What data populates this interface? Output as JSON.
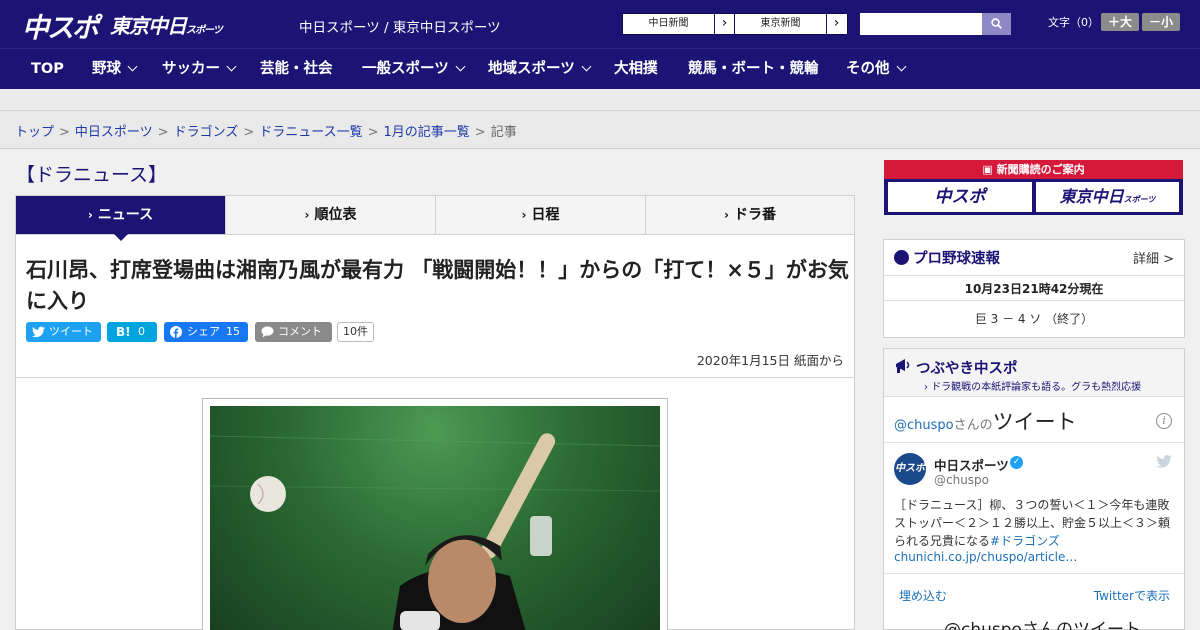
{
  "header": {
    "logo_main": "中スポ",
    "logo_sub": "東京中日",
    "logo_sub_small": "スポーツ",
    "site_links": "中日スポーツ / 東京中日スポーツ",
    "paper_buttons": [
      "中日新聞",
      "東京新聞"
    ],
    "search_placeholder": "",
    "font_size_label": "文字（0）",
    "font_plus": "＋大",
    "font_minus": "－小"
  },
  "nav": {
    "items": [
      {
        "label": "TOP",
        "has_menu": false
      },
      {
        "label": "野球",
        "has_menu": true
      },
      {
        "label": "サッカー",
        "has_menu": true
      },
      {
        "label": "芸能・社会",
        "has_menu": false
      },
      {
        "label": "一般スポーツ",
        "has_menu": true
      },
      {
        "label": "地域スポーツ",
        "has_menu": true
      },
      {
        "label": "大相撲",
        "has_menu": false
      },
      {
        "label": "競馬・ボート・競輪",
        "has_menu": false
      },
      {
        "label": "その他",
        "has_menu": true
      }
    ]
  },
  "breadcrumb": {
    "links": [
      "トップ",
      "中日スポーツ",
      "ドラゴンズ",
      "ドラニュース一覧",
      "1月の記事一覧"
    ],
    "current": "記事",
    "separator": ">"
  },
  "section_title": "【ドラニュース】",
  "tabs": [
    {
      "label": "ニュース",
      "active": true
    },
    {
      "label": "順位表",
      "active": false
    },
    {
      "label": "日程",
      "active": false
    },
    {
      "label": "ドラ番",
      "active": false
    }
  ],
  "article": {
    "headline": "石川昂、打席登場曲は湘南乃風が最有力 「戦闘開始！！」からの「打て！×５」がお気に入り",
    "share": {
      "tweet": "ツイート",
      "hatena_count": "0",
      "facebook": "シェア",
      "facebook_count": "15",
      "comment": "コメント",
      "comment_count": "10件"
    },
    "dateline": "2020年1月15日 紙面から"
  },
  "sidebar": {
    "ad": {
      "heading": "新聞購読のご案内",
      "brand_1": "中スポ",
      "brand_2": "東京中日",
      "brand_2_small": "スポーツ"
    },
    "score": {
      "title": "プロ野球速報",
      "detail": "詳細 >",
      "time": "10月23日21時42分現在",
      "game": "巨 3 － 4 ソ （終了）"
    },
    "twitter": {
      "title": "つぶやき中スポ",
      "subtitle": "ドラ観戦の本紙評論家も語る。グラも熱烈応援",
      "handle": "@chuspo",
      "handle_suffix": "さんの",
      "handle_big": "ツイート",
      "avatar_text": "中スポ",
      "account_name": "中日スポーツ",
      "account_handle": "@chuspo",
      "tweet_text": "［ドラニュース］柳、３つの誓い＜１＞今年も連敗ストッパー＜２＞１２勝以上、貯金５以上＜３＞頼られる兄貴になる",
      "tweet_tag": "#ドラゴンズ",
      "tweet_link": "chunichi.co.jp/chuspo/article…",
      "embed": "埋め込む",
      "view_on_twitter": "Twitterで表示",
      "more": "@chuspoさんのツイート"
    }
  },
  "colors": {
    "brand_navy": "#1b1475",
    "ad_red": "#d4193b",
    "twitter_blue": "#1da1f2",
    "facebook_blue": "#1877f2",
    "hatena_blue": "#00a4de",
    "link_blue": "#1f3aa8"
  }
}
